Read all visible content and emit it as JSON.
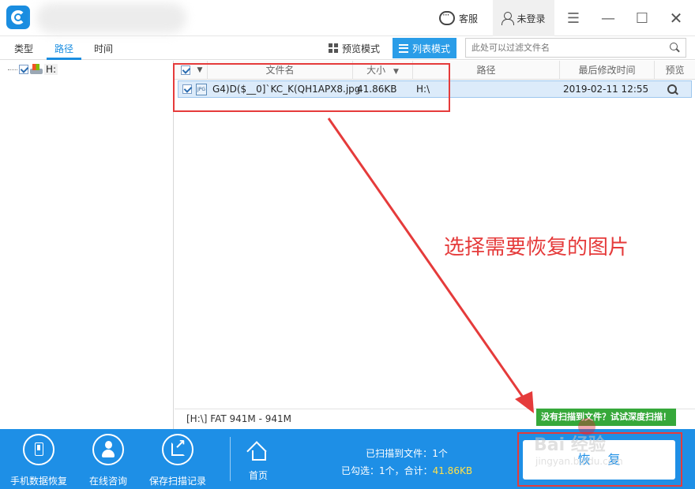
{
  "titlebar": {
    "service_label": "客服",
    "login_label": "未登录"
  },
  "tabs": [
    {
      "label": "类型",
      "active": false
    },
    {
      "label": "路径",
      "active": true
    },
    {
      "label": "时间",
      "active": false
    }
  ],
  "view_modes": {
    "preview_label": "预览模式",
    "list_label": "列表模式",
    "active": "list"
  },
  "filter": {
    "placeholder": "此处可以过滤文件名"
  },
  "tree": {
    "root_label": "H:",
    "checked": true
  },
  "columns": {
    "name": "文件名",
    "size": "大小",
    "path": "路径",
    "modified": "最后修改时间",
    "preview": "预览"
  },
  "files": [
    {
      "icon_text": "JPG",
      "name": "G4)D($__0]`KC_K(QH1APX8.jpg",
      "size": "41.86KB",
      "path": "H:\\",
      "modified": "2019-02-11  12:55",
      "checked": true
    }
  ],
  "status": {
    "partition_info": "[H:\\] FAT 941M - 941M",
    "deep_scan_link": "没有扫描到文件？试试深度扫描！"
  },
  "bottombar": {
    "phone_recovery": "手机数据恢复",
    "online_consult": "在线咨询",
    "save_scan_record": "保存扫描记录",
    "home": "首页",
    "scanned_prefix": "已扫描到文件：",
    "scanned_count": "1个",
    "selected_prefix": "已勾选：",
    "selected_count": "1个，合计：",
    "selected_total": "41.86KB",
    "recover_label": "恢复"
  },
  "annotation": {
    "text": "选择需要恢复的图片"
  },
  "watermark": {
    "brand": "Bai 经验",
    "url": "jingyan.baidu.com"
  },
  "colors": {
    "accent": "#1a8de0",
    "bottombar": "#1e8fe6",
    "annotation": "#e53b3b",
    "deep_scan": "#36a83a",
    "highlight_total": "#ffe14a"
  }
}
